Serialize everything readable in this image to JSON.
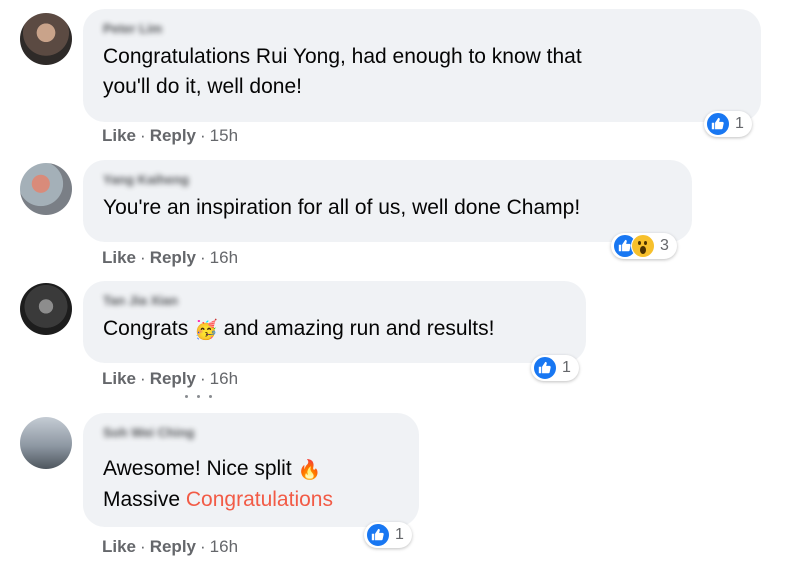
{
  "comments": [
    {
      "author": "Peter Lim",
      "lines": [
        "Congratulations Rui Yong, had enough to know that",
        "you'll do it, well done!"
      ],
      "like_label": "Like",
      "reply_label": "Reply",
      "separator": "·",
      "time": "15h",
      "reactions": [
        "like"
      ],
      "reaction_count": "1"
    },
    {
      "author": "Yang Kaiheng",
      "lines": [
        "You're an inspiration for all of us, well done Champ!"
      ],
      "like_label": "Like",
      "reply_label": "Reply",
      "separator": "·",
      "time": "16h",
      "reactions": [
        "like",
        "wow"
      ],
      "reaction_count": "3"
    },
    {
      "author": "Tan Jia Xian",
      "text_before": "Congrats",
      "emoji": "🥳",
      "text_after": "and amazing run and results!",
      "like_label": "Like",
      "reply_label": "Reply",
      "separator": "·",
      "time": "16h",
      "reactions": [
        "like"
      ],
      "reaction_count": "1"
    },
    {
      "author": "Soh Wei Ching",
      "line1_text": "Awesome! Nice split",
      "line1_emoji": "🔥",
      "line2_text": "Massive",
      "line2_highlight": "Congratulations",
      "like_label": "Like",
      "reply_label": "Reply",
      "separator": "·",
      "time": "16h",
      "reactions": [
        "like"
      ],
      "reaction_count": "1"
    }
  ],
  "colors": {
    "bubble": "#f0f2f5",
    "meta": "#65676b",
    "like_blue": "#1877f2",
    "highlight": "#f25b46",
    "wow_yellow": "#f7c02c"
  }
}
